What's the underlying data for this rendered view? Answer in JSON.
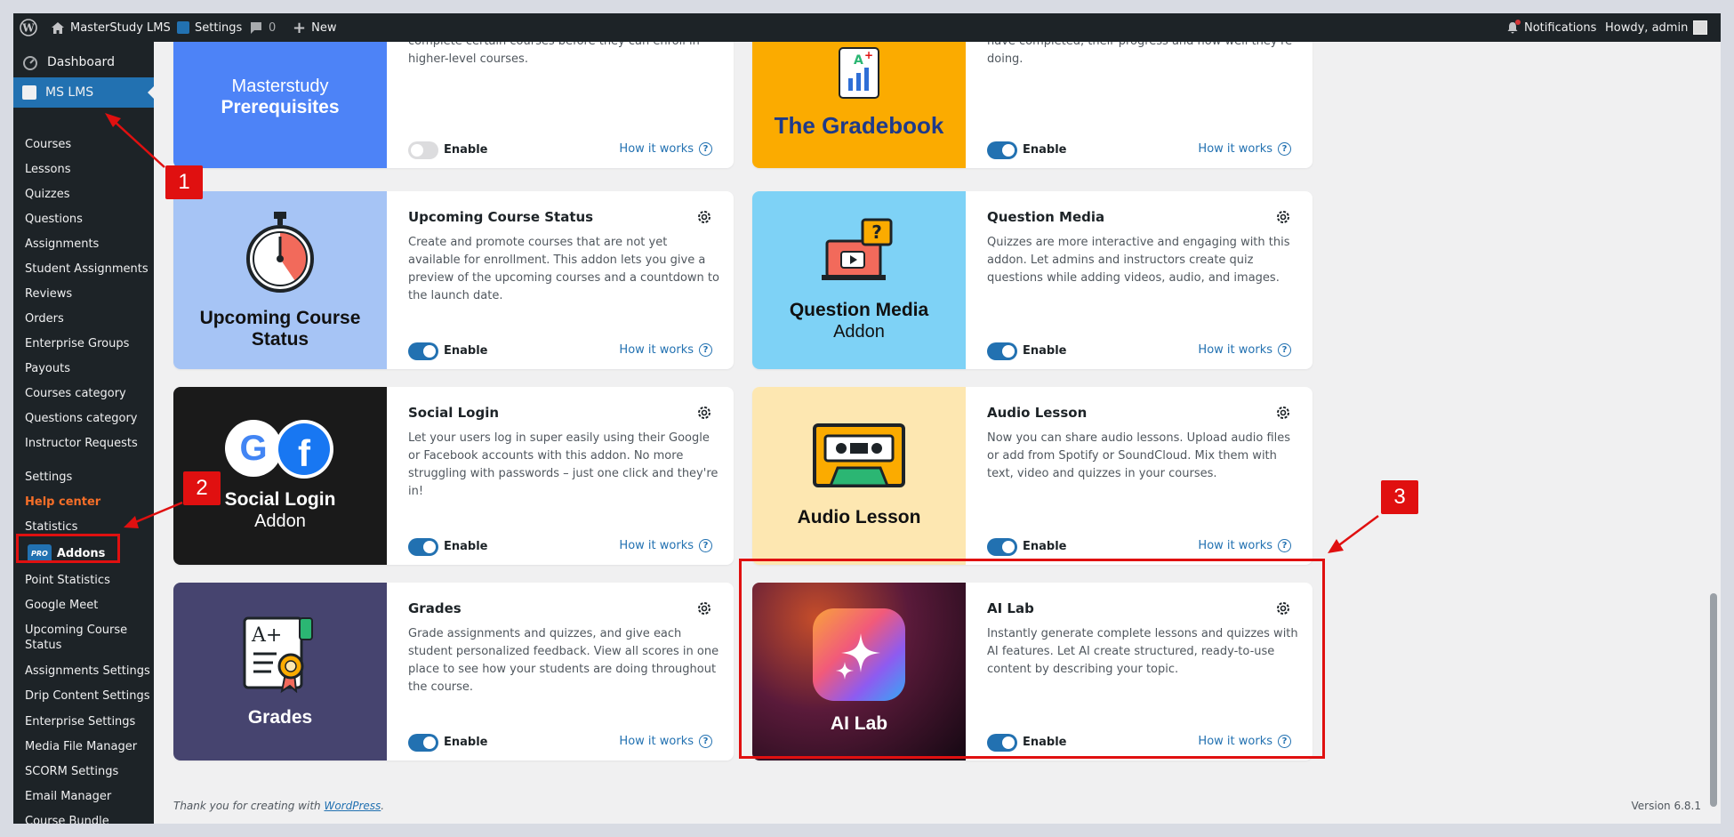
{
  "adminbar": {
    "site_name": "MasterStudy LMS",
    "settings": "Settings",
    "comments": "0",
    "new": "New",
    "notifications": "Notifications",
    "howdy": "Howdy, admin"
  },
  "sidebar": {
    "dashboard": "Dashboard",
    "ms_lms": "MS LMS",
    "items": [
      "Courses",
      "Lessons",
      "Quizzes",
      "Questions",
      "Assignments",
      "Student Assignments",
      "Reviews",
      "Orders",
      "Enterprise Groups",
      "Payouts",
      "Courses category",
      "Questions category",
      "Instructor Requests"
    ],
    "settings": "Settings",
    "help_center": "Help center",
    "statistics": "Statistics",
    "pro_badge": "PRO",
    "addons": "Addons",
    "items2": [
      "Point Statistics",
      "Google Meet",
      "Upcoming Course Status",
      "Assignments Settings",
      "Drip Content Settings",
      "Enterprise Settings",
      "Media File Manager",
      "SCORM Settings",
      "Email Manager",
      "Course Bundle"
    ]
  },
  "cards": {
    "prereq": {
      "thumb_line1": "Masterstudy",
      "thumb_line2": "Prerequisites",
      "desc": "complete certain courses before they can enroll in higher-level courses.",
      "enable": "Enable",
      "how": "How it works"
    },
    "gradebook": {
      "thumb": "The Gradebook",
      "desc": "have completed, their progress and how well they're doing.",
      "enable": "Enable",
      "how": "How it works"
    },
    "upcoming": {
      "title": "Upcoming Course Status",
      "thumb_title": "Upcoming Course Status",
      "desc": "Create and promote courses that are not yet available for enrollment. This addon lets you give a preview of the upcoming courses and a countdown to the launch date.",
      "enable": "Enable",
      "how": "How it works"
    },
    "question_media": {
      "title": "Question Media",
      "thumb_title": "Question Media",
      "thumb_sub": "Addon",
      "desc": "Quizzes are more interactive and engaging with this addon. Let admins and instructors create quiz questions while adding videos, audio, and images.",
      "enable": "Enable",
      "how": "How it works"
    },
    "social_login": {
      "title": "Social Login",
      "thumb_title": "Social Login",
      "thumb_sub": "Addon",
      "desc": "Let your users log in super easily using their Google or Facebook accounts with this addon. No more struggling with passwords – just one click and they're in!",
      "enable": "Enable",
      "how": "How it works"
    },
    "audio_lesson": {
      "title": "Audio Lesson",
      "thumb_title": "Audio Lesson",
      "desc": "Now you can share audio lessons. Upload audio files or add from Spotify or SoundCloud. Mix them with text, video and quizzes in your courses.",
      "enable": "Enable",
      "how": "How it works"
    },
    "grades": {
      "title": "Grades",
      "thumb_title": "Grades",
      "desc": "Grade assignments and quizzes, and give each student personalized feedback. View all scores in one place to see how your students are doing throughout the course.",
      "enable": "Enable",
      "how": "How it works"
    },
    "ai_lab": {
      "title": "AI Lab",
      "thumb_title": "AI Lab",
      "desc": "Instantly generate complete lessons and quizzes with AI features. Let AI create structured, ready-to-use content by describing your topic.",
      "enable": "Enable",
      "how": "How it works"
    }
  },
  "footer": {
    "thanks": "Thank you for creating with",
    "wp_link": "WordPress",
    "period": ".",
    "version": "Version 6.8.1"
  },
  "annotations": [
    "1",
    "2",
    "3"
  ],
  "colors": {
    "accent": "#2271b1",
    "annotation_red": "#e01010",
    "help_center": "#f56e28",
    "ms_lms_active": "#2271b1"
  }
}
